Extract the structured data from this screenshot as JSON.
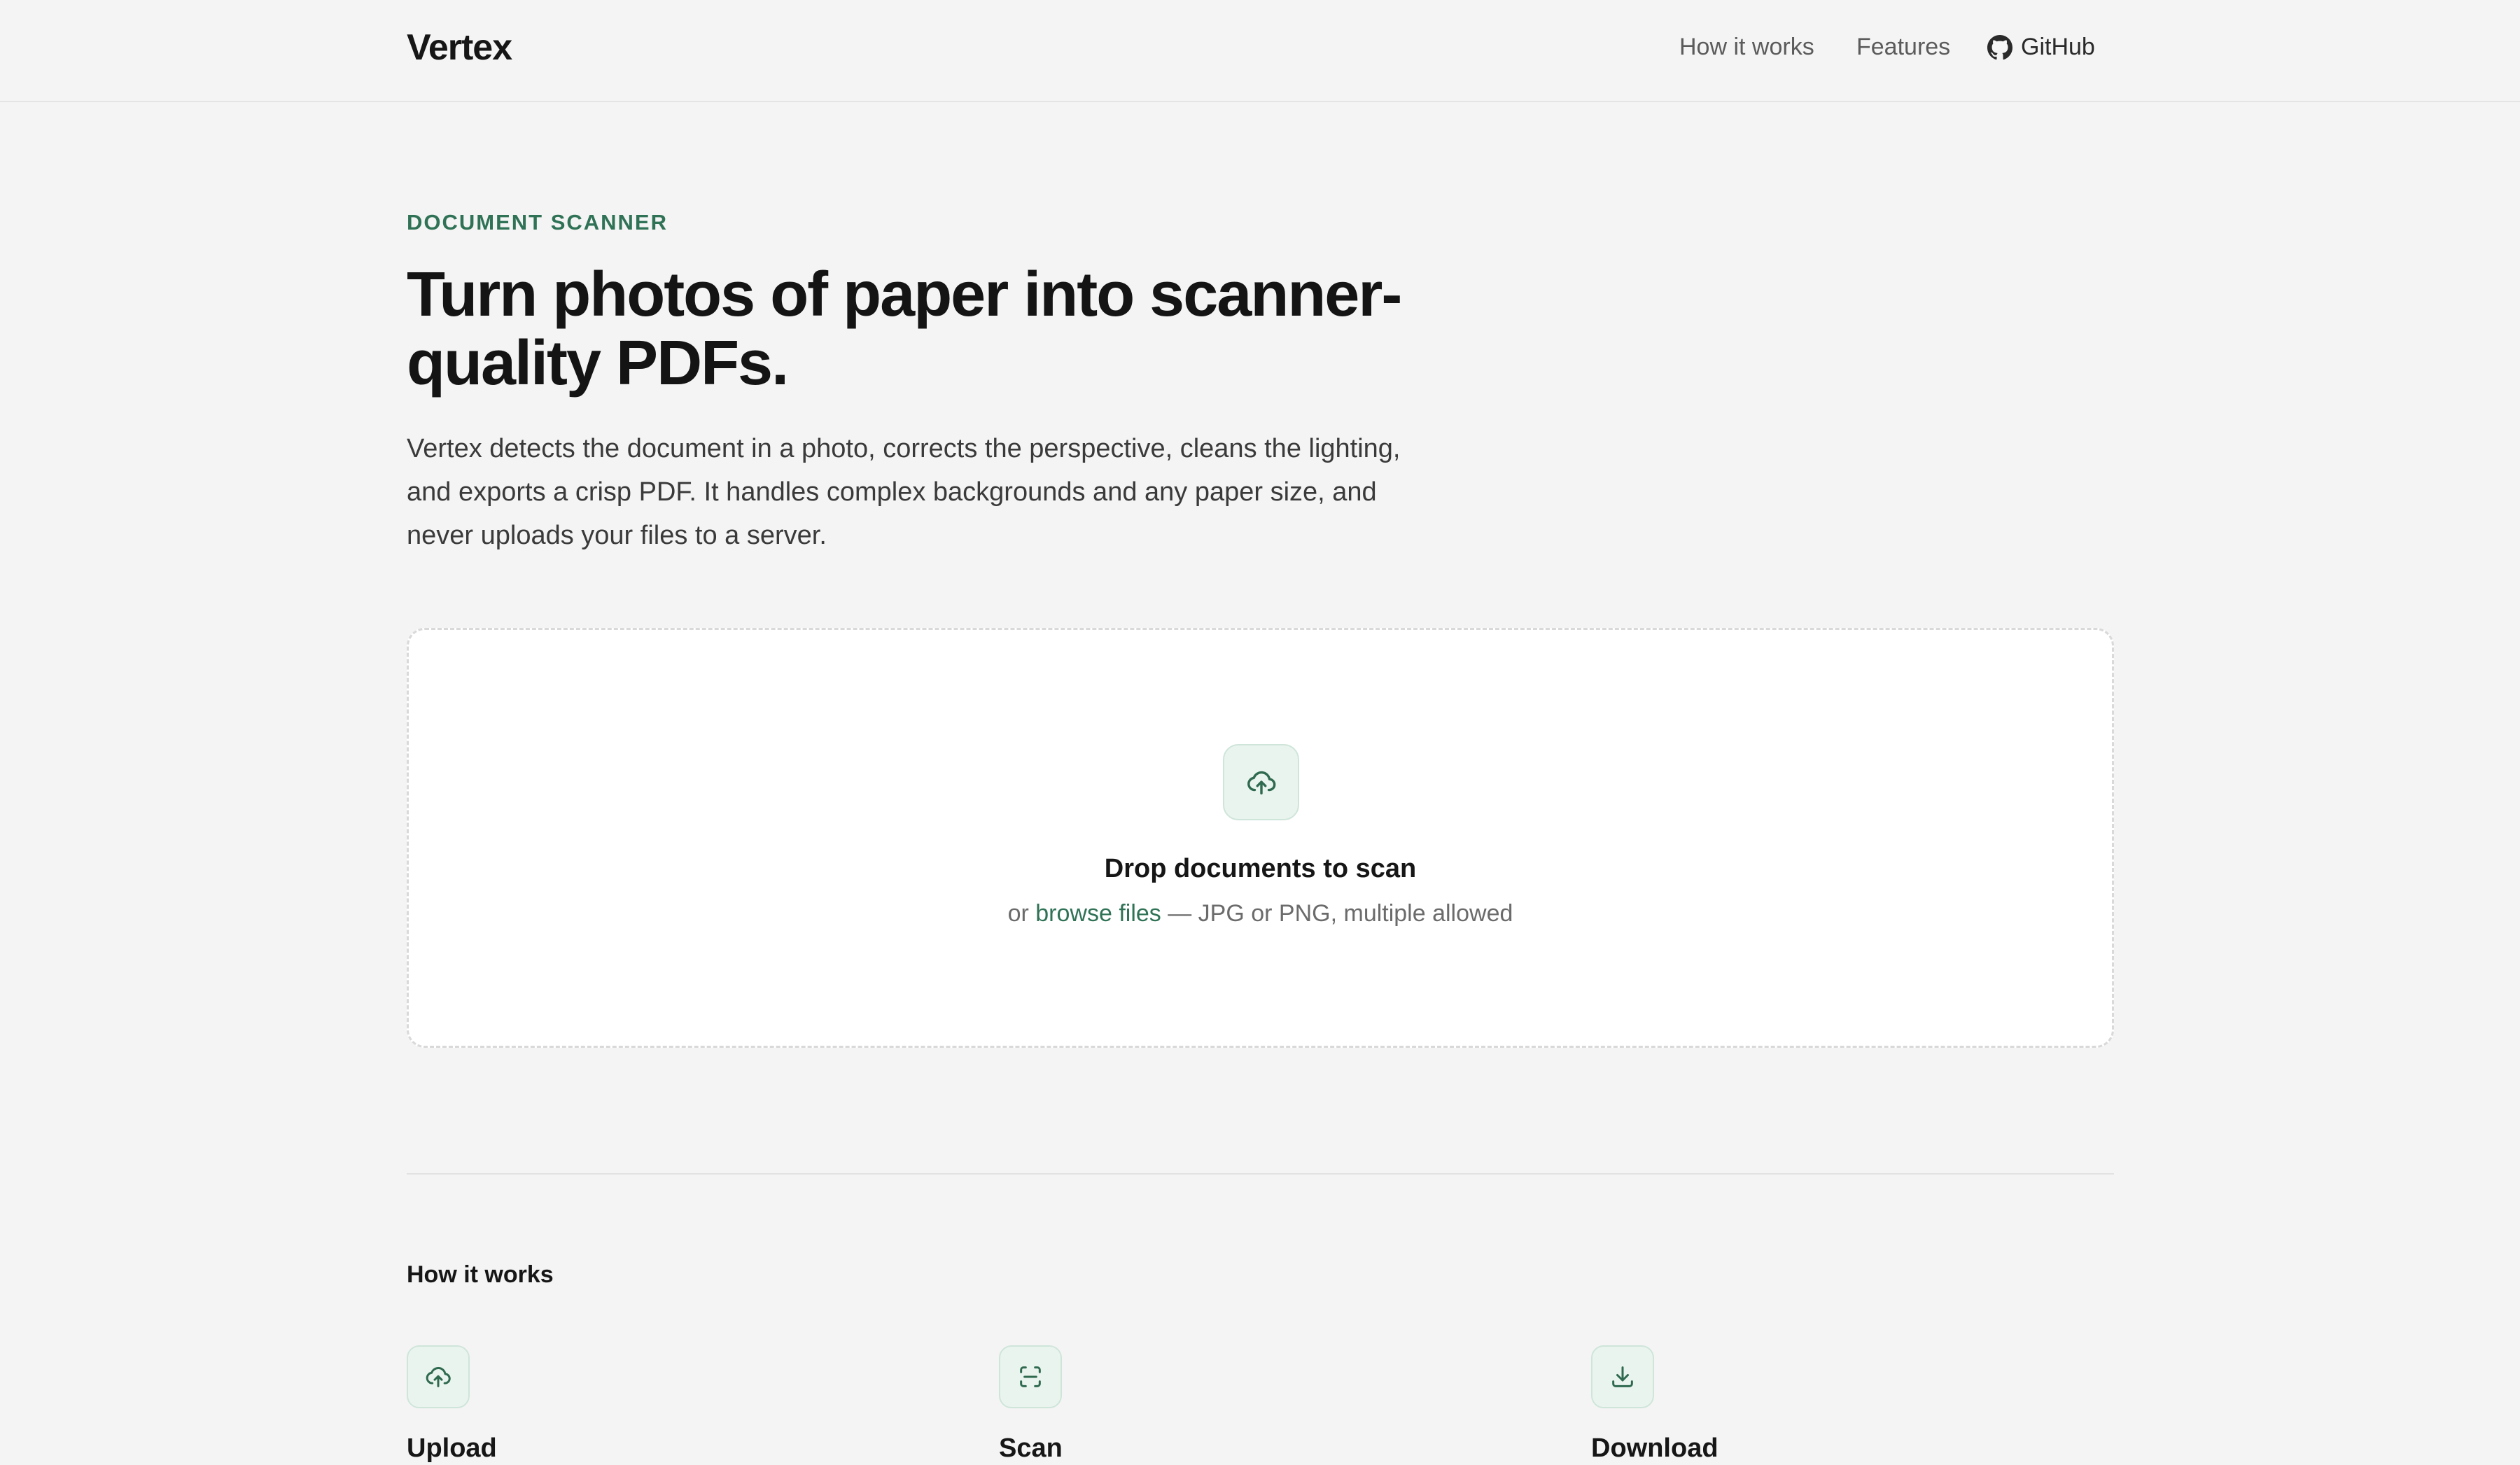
{
  "header": {
    "brand": "Vertex",
    "nav": [
      {
        "label": "How it works"
      },
      {
        "label": "Features"
      },
      {
        "label": "GitHub",
        "icon": "github-icon"
      }
    ]
  },
  "hero": {
    "eyebrow": "DOCUMENT SCANNER",
    "headline": "Turn photos of paper into scanner-quality PDFs.",
    "lede": "Vertex detects the document in a photo, corrects the perspective, cleans the lighting, and exports a crisp PDF. It handles complex backgrounds and any paper size, and never uploads your files to a server."
  },
  "dropzone": {
    "icon": "cloud-upload-icon",
    "title": "Drop documents to scan",
    "sub_prefix": "or ",
    "browse_label": "browse files",
    "sub_suffix": " — JPG or PNG, multiple allowed"
  },
  "how_it_works": {
    "title": "How it works",
    "steps": [
      {
        "title": "Upload",
        "icon": "cloud-upload-icon"
      },
      {
        "title": "Scan",
        "icon": "scan-frame-icon"
      },
      {
        "title": "Download",
        "icon": "download-icon"
      }
    ]
  },
  "colors": {
    "accent": "#2f7256",
    "icon_bg": "#eaf4ef",
    "page_bg": "#f4f4f4"
  }
}
